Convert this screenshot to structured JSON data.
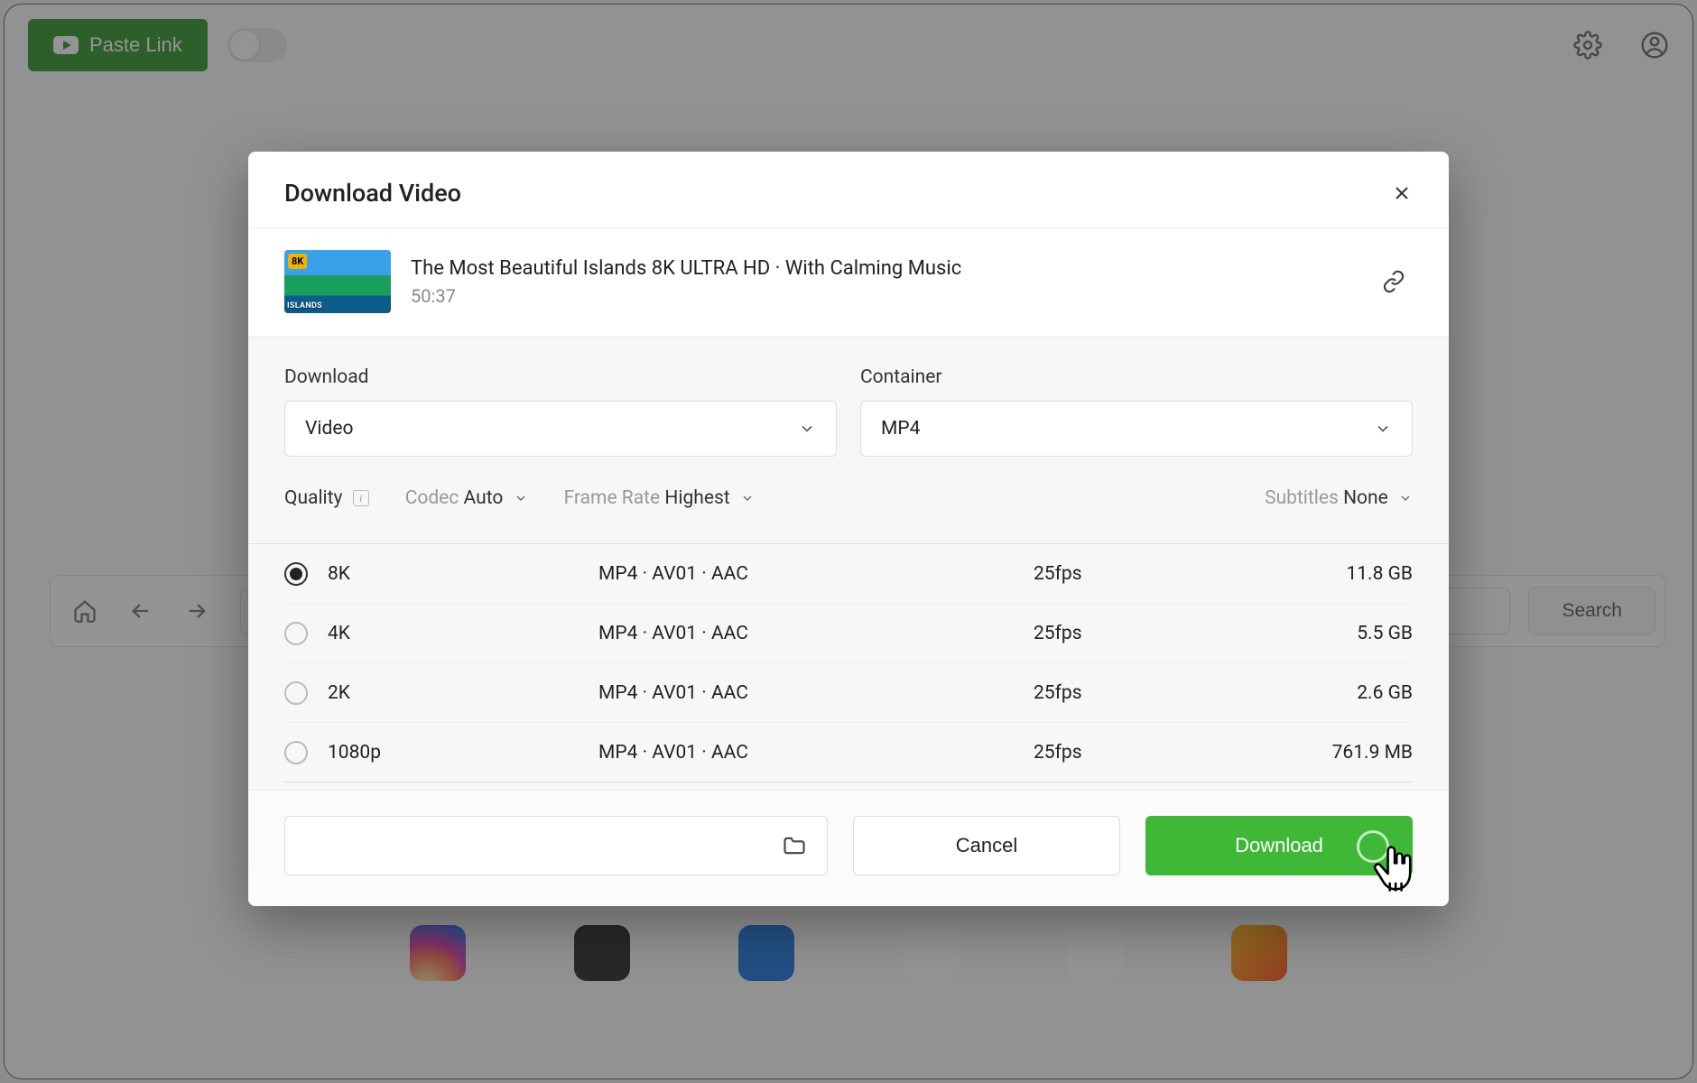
{
  "topbar": {
    "paste_link_label": "Paste Link"
  },
  "browser": {
    "search_label": "Search"
  },
  "modal": {
    "title": "Download Video",
    "video": {
      "title": "The Most Beautiful Islands 8K ULTRA HD · With Calming Music",
      "duration": "50:37",
      "thumb_badge": "8K",
      "thumb_caption": "ISLANDS"
    },
    "download_label": "Download",
    "download_selected": "Video",
    "container_label": "Container",
    "container_selected": "MP4",
    "filters": {
      "quality_label": "Quality",
      "codec_label": "Codec",
      "codec_value": "Auto",
      "framerate_label": "Frame Rate",
      "framerate_value": "Highest",
      "subtitles_label": "Subtitles",
      "subtitles_value": "None"
    },
    "qualities": [
      {
        "name": "8K",
        "codec": "MP4 · AV01 · AAC",
        "fps": "25fps",
        "size": "11.8 GB",
        "selected": true
      },
      {
        "name": "4K",
        "codec": "MP4 · AV01 · AAC",
        "fps": "25fps",
        "size": "5.5 GB",
        "selected": false
      },
      {
        "name": "2K",
        "codec": "MP4 · AV01 · AAC",
        "fps": "25fps",
        "size": "2.6 GB",
        "selected": false
      },
      {
        "name": "1080p",
        "codec": "MP4 · AV01 · AAC",
        "fps": "25fps",
        "size": "761.9 MB",
        "selected": false
      }
    ],
    "cancel_label": "Cancel",
    "download_btn_label": "Download"
  },
  "colors": {
    "accent_green": "#3fb838",
    "paste_green": "#1c8b18"
  }
}
